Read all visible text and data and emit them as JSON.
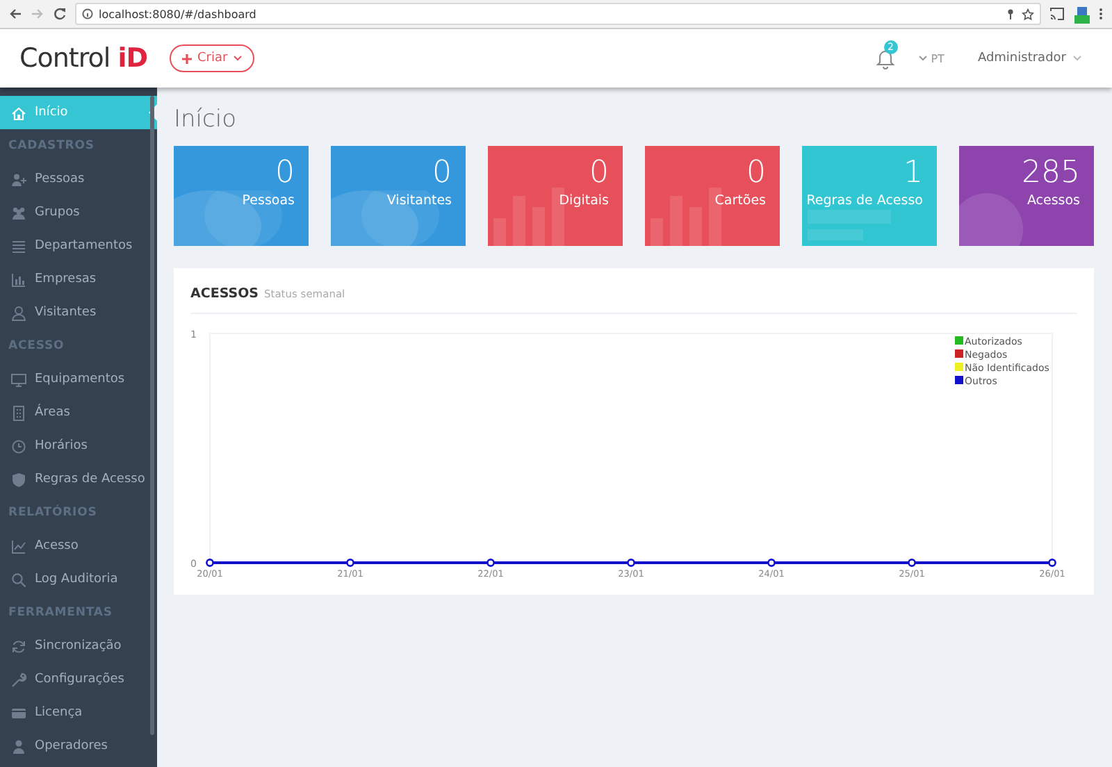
{
  "browser": {
    "url": "localhost:8080/#/dashboard"
  },
  "header": {
    "logo": "Control **iD**",
    "create_button": "Criar",
    "notifications": {
      "count": "2"
    },
    "language": "PT",
    "user": "Administrador"
  },
  "sidebar": {
    "items": [
      {
        "kind": "link",
        "label": "Início",
        "selected": true
      },
      {
        "kind": "header",
        "label": "CADASTROS"
      },
      {
        "kind": "link",
        "label": "Pessoas",
        "selected": false
      },
      {
        "kind": "link",
        "label": "Grupos",
        "selected": false
      },
      {
        "kind": "link",
        "label": "Departamentos",
        "selected": false
      },
      {
        "kind": "link",
        "label": "Empresas",
        "selected": false
      },
      {
        "kind": "link",
        "label": "Visitantes",
        "selected": false
      },
      {
        "kind": "header",
        "label": "ACESSO"
      },
      {
        "kind": "link",
        "label": "Equipamentos",
        "selected": false
      },
      {
        "kind": "link",
        "label": "Áreas",
        "selected": false
      },
      {
        "kind": "link",
        "label": "Horários",
        "selected": false
      },
      {
        "kind": "link",
        "label": "Regras de Acesso",
        "selected": false
      },
      {
        "kind": "header",
        "label": "RELATÓRIOS"
      },
      {
        "kind": "link",
        "label": "Acesso",
        "selected": false
      },
      {
        "kind": "link",
        "label": "Log Auditoria",
        "selected": false
      },
      {
        "kind": "header",
        "label": "FERRAMENTAS"
      },
      {
        "kind": "link",
        "label": "Sincronização",
        "selected": false
      },
      {
        "kind": "link",
        "label": "Configurações",
        "selected": false
      },
      {
        "kind": "link",
        "label": "Licença",
        "selected": false
      },
      {
        "kind": "link",
        "label": "Operadores",
        "selected": false
      }
    ]
  },
  "page": {
    "title": "Início"
  },
  "stats": [
    {
      "value": "0",
      "label": "Pessoas",
      "color": "#3598dc"
    },
    {
      "value": "0",
      "label": "Visitantes",
      "color": "#3598dc"
    },
    {
      "value": "0",
      "label": "Digitais",
      "color": "#e7505a"
    },
    {
      "value": "0",
      "label": "Cartões",
      "color": "#e7505a"
    },
    {
      "value": "1",
      "label": "Regras de Acesso",
      "color": "#32c5d2"
    },
    {
      "value": "285",
      "label": "Acessos",
      "color": "#8e44ad"
    }
  ],
  "chart_panel": {
    "title": "ACESSOS",
    "subtitle": "Status semanal",
    "chart_data": {
      "type": "line",
      "legend": true,
      "categories": [
        "20/01",
        "21/01",
        "22/01",
        "23/01",
        "24/01",
        "25/01",
        "26/01"
      ],
      "ylim": [
        0,
        1
      ],
      "yticks": [
        {
          "value": 0,
          "label": "0"
        },
        {
          "value": 1,
          "label": "1"
        }
      ],
      "series": [
        {
          "name": "Autorizados",
          "color": "#22bb22",
          "marker": "circle",
          "values": [
            null,
            null,
            null,
            null,
            null,
            null,
            null
          ]
        },
        {
          "name": "Negados",
          "color": "#cc2222",
          "marker": "circle",
          "values": [
            null,
            null,
            null,
            null,
            null,
            null,
            null
          ]
        },
        {
          "name": "Não Identificados",
          "color": "#eeee22",
          "marker": "circle",
          "values": [
            null,
            null,
            null,
            null,
            null,
            null,
            null
          ]
        },
        {
          "name": "Outros",
          "color": "#1111cc",
          "marker": "circle",
          "values": [
            0,
            0,
            0,
            0,
            0,
            0,
            0
          ]
        }
      ]
    }
  }
}
